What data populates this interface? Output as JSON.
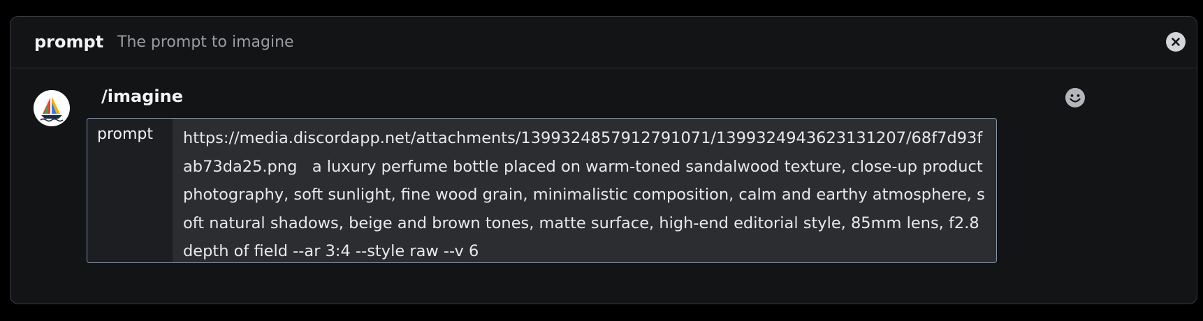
{
  "header": {
    "option_name": "prompt",
    "option_description": "The prompt to imagine"
  },
  "command": {
    "name": "/imagine"
  },
  "option": {
    "label": "prompt",
    "value": "https://media.discordapp.net/attachments/1399324857912791071/1399324943623131207/68f7d93fab73da25.png   a luxury perfume bottle placed on warm-toned sandalwood texture, close-up product photography, soft sunlight, fine wood grain, minimalistic composition, calm and earthy atmosphere, soft natural shadows, beige and brown tones, matte surface, high-end editorial style, 85mm lens, f2.8 depth of field --ar 3:4 --style raw --v 6"
  },
  "icons": {
    "close": "close-circle-icon",
    "emoji": "smiley-face-icon",
    "avatar": "sailboat-logo"
  },
  "colors": {
    "panel_bg": "#131416",
    "input_bg": "#2b2d31",
    "focus_border": "#7a97b8",
    "text_primary": "#f2f3f5",
    "text_muted": "#9c9da3"
  }
}
